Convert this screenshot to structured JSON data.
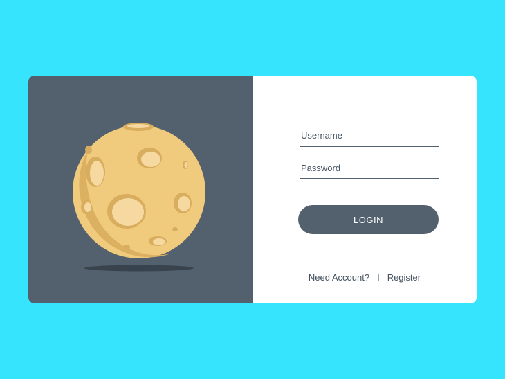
{
  "login_form": {
    "username_placeholder": "Username",
    "password_placeholder": "Password",
    "login_label": "LOGIN",
    "need_account_text": "Need Account?",
    "separator": "I",
    "register_label": "Register"
  },
  "colors": {
    "background": "#36e4fd",
    "illustration_panel": "#53616e",
    "form_panel": "#ffffff",
    "button": "#53616e",
    "moon_body": "#f0ca7d",
    "moon_crater": "#d9ad5e",
    "moon_crater_light": "#f6d9a0"
  },
  "icons": {
    "illustration": "moon-icon"
  }
}
